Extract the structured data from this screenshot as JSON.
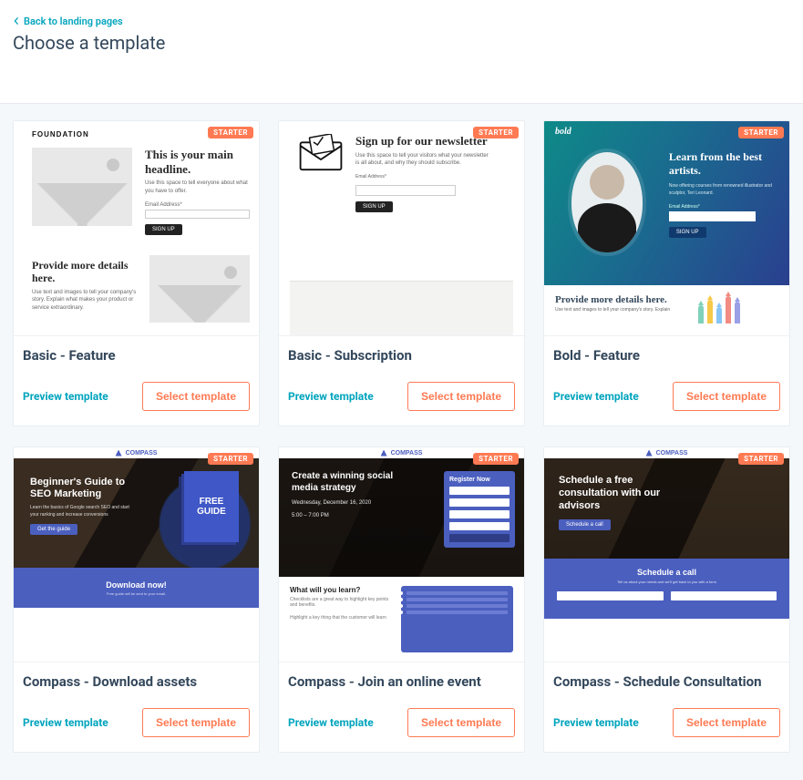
{
  "header": {
    "back_label": "Back to landing pages",
    "page_title": "Choose a template"
  },
  "labels": {
    "badge": "STARTER",
    "preview": "Preview template",
    "select": "Select template"
  },
  "templates": [
    {
      "title": "Basic - Feature",
      "preview": {
        "logo": "FOUNDATION",
        "headline": "This is your main headline.",
        "sub": "Use this space to tell everyone about what you have to offer.",
        "email_label": "Email Address*",
        "signup": "SIGN UP",
        "details_h": "Provide more details here.",
        "details_p": "Use text and images to tell your company's story. Explain what makes your product or service extraordinary."
      }
    },
    {
      "title": "Basic - Subscription",
      "preview": {
        "headline": "Sign up for our newsletter",
        "sub": "Use this space to tell your visitors what your newsletter is all about, and why they should subscribe.",
        "email_label": "Email Address*",
        "signup": "SIGN UP"
      }
    },
    {
      "title": "Bold - Feature",
      "preview": {
        "logo": "bold",
        "headline": "Learn from the best artists.",
        "sub": "Now offering courses from renowned illustrator and sculptor, Teri Leonard.",
        "email_label": "Email Address*",
        "signup": "SIGN UP",
        "details_h": "Provide more details here.",
        "details_p": "Use text and images to tell your company's story. Explain"
      }
    },
    {
      "title": "Compass - Download assets",
      "preview": {
        "brand": "COMPASS",
        "headline": "Beginner's Guide to SEO Marketing",
        "sub": "Learn the basics of Google search SEO and start your ranking and increase conversions",
        "cta": "Get the guide",
        "book_label": "FREE GUIDE",
        "strip_h": "Download now!",
        "strip_sub": "Free guide will be sent to your email."
      }
    },
    {
      "title": "Compass - Join an online event",
      "preview": {
        "brand": "COMPASS",
        "headline": "Create a winning social media strategy",
        "date": "Wednesday, December 16, 2020",
        "time": "5:00 – 7:00 PM",
        "form_h": "Register Now",
        "learn_h": "What will you learn?",
        "learn_sub": "Checklists are a great way to highlight key points and benefits.",
        "learn_body": "Highlight a key thing that the customer will learn"
      }
    },
    {
      "title": "Compass - Schedule Consultation",
      "preview": {
        "brand": "COMPASS",
        "headline": "Schedule a free consultation with our advisors",
        "cta": "Schedule a call",
        "strip_h": "Schedule a call",
        "strip_sub": "Tell us about your needs and we'll get back to you with a form"
      }
    }
  ]
}
